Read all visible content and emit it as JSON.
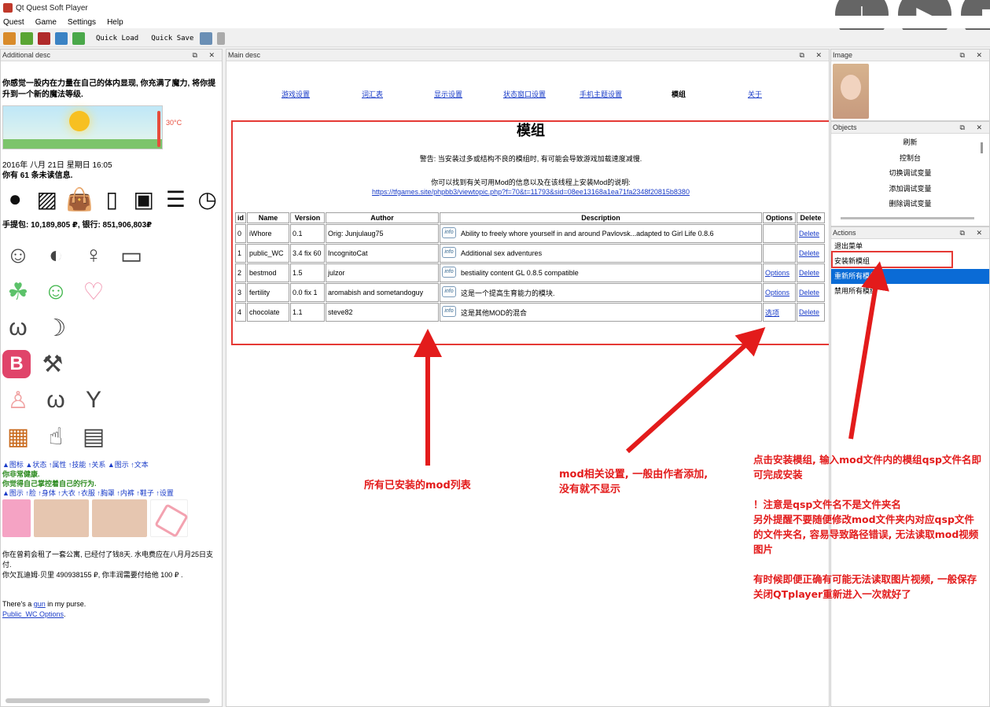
{
  "app": {
    "title": "Qt Quest Soft Player"
  },
  "menu": {
    "items": [
      "Quest",
      "Game",
      "Settings",
      "Help"
    ]
  },
  "toolbar": {
    "quick_load": "Quick Load",
    "quick_save": "Quick Save"
  },
  "panels": {
    "additional_desc": "Additional desc",
    "main_desc": "Main desc",
    "image": "Image",
    "objects": "Objects",
    "actions": "Actions",
    "controls": "⧉ ✕"
  },
  "left": {
    "intro": "你感觉一股内在力量在自己的体内显现, 你充满了魔力, 将你提升到一个新的魔法等级.",
    "temp": "30°C",
    "date": "2016年 八月 21日 星期日 16:05",
    "unread": "你有 61 条未读信息.",
    "money": "手提包: 10,189,805 ₽, 银行: 851,906,803₽",
    "links1": "▲图标 ▲状态 ↑属性 ↑技能 ↑关系 ▲图示 ↑文本",
    "health1": "你非常健康.",
    "health2": "你觉得自己掌控着自己的行为.",
    "links2": "▲图示 ↑脸 ↑身体 ↑大衣 ↑衣服 ↑胸罩 ↑内裤 ↑鞋子 ↑设置",
    "rent": "你在曾莉会租了一套公寓, 已经付了钱8天. 水电费应在八月月25日支付.",
    "debt": "你欠瓦迪姆·贝里 490938155 ₽, 你丰润需要付给他 100 ₽ .",
    "purse_pre": "There's a ",
    "purse_link": "gun",
    "purse_post": " in my purse.",
    "options_link": "Public_WC Options",
    "options_post": "."
  },
  "main": {
    "nav": [
      "游戏设置",
      "词汇表",
      "显示设置",
      "状态窗口设置",
      "手机主题设置",
      "模组",
      "关于"
    ],
    "title": "模组",
    "warning": "警告: 当安装过多或结构不良的模组时, 有可能会导致游戏加载速度减慢.",
    "info_text": "你可以找到有关可用Mod的信息以及在该线程上安装Mod的说明:",
    "info_link": "https://tfgames.site/phpbb3/viewtopic.php?f=70&t=11793&sid=08ee13168a1ea71fa2348f20815b8380",
    "headers": [
      "id",
      "Name",
      "Version",
      "Author",
      "Description",
      "Options",
      "Delete"
    ],
    "info_tag": "info",
    "rows": [
      {
        "id": "0",
        "name": "iWhore",
        "version": "0.1",
        "author": "Orig: Junjulaug75",
        "description": "Ability to freely whore yourself in and around Pavlovsk...adapted to Girl Life 0.8.6",
        "options": "",
        "delete": "Delete"
      },
      {
        "id": "1",
        "name": "public_WC",
        "version": "3.4 fix 60",
        "author": "IncognitoCat",
        "description": "Additional sex adventures",
        "options": "",
        "delete": "Delete"
      },
      {
        "id": "2",
        "name": "bestmod",
        "version": "1.5",
        "author": "julzor",
        "description": "bestiality content GL 0.8.5 compatible",
        "options": "Options",
        "delete": "Delete"
      },
      {
        "id": "3",
        "name": "fertility",
        "version": "0.0 fix 1",
        "author": "aromabish and sometandoguy",
        "description": "这是一个提高生育能力的模块.",
        "options": "Options",
        "delete": "Delete"
      },
      {
        "id": "4",
        "name": "chocolate",
        "version": "1.1",
        "author": "steve82",
        "description": "这是其他MOD的混合",
        "options": "选项",
        "delete": "Delete"
      }
    ]
  },
  "objects": {
    "items": [
      "刷新",
      "控制台",
      "切换调试变量",
      "添加调试变量",
      "删除调试变量"
    ]
  },
  "actions": {
    "items": [
      "退出菜单",
      "安装新模组",
      "重新所有模组",
      "禁用所有模组"
    ],
    "selected_index": 2
  },
  "annotations": {
    "list": "所有已安装的mod列表",
    "settings": "mod相关设置, 一般由作者添加,\n没有就不显示",
    "install": "点击安装模组, 输入mod文件内的模组qsp文件名即可完成安装\n\n！注意是qsp文件名不是文件夹名\n另外提醒不要随便修改mod文件夹内对应qsp文件的文件夹名, 容易导致路径错误, 无法读取mod视频图片\n\n有时候即便正确有可能无法读取图片视频, 一般保存关闭QTplayer重新进入一次就好了",
    "color": "#e31b1b"
  }
}
